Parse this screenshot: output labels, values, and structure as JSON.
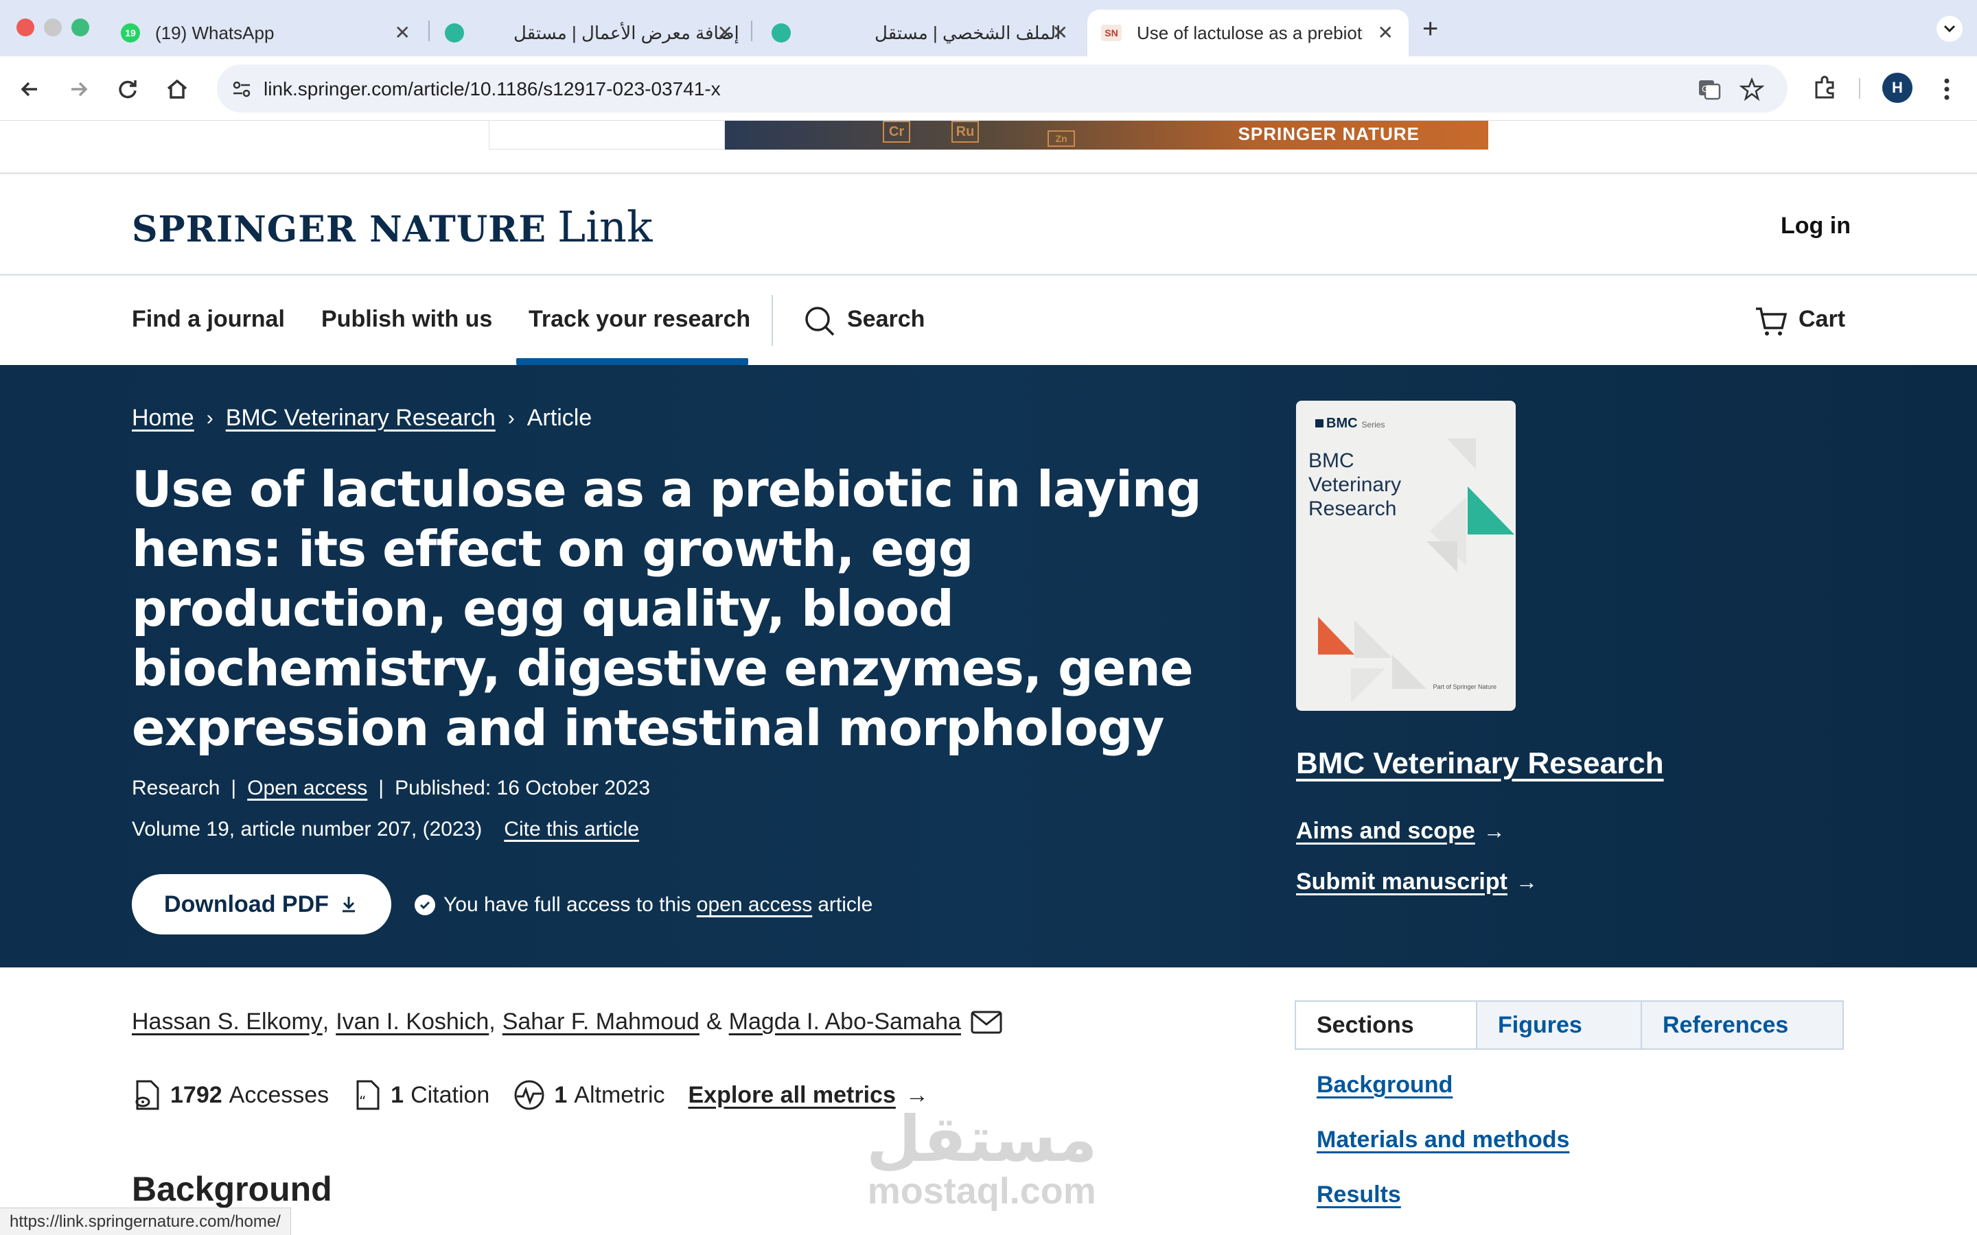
{
  "browser": {
    "tabs": [
      {
        "title": "(19) WhatsApp",
        "badge": "19"
      },
      {
        "title": "إضافة معرض الأعمال | مستقل"
      },
      {
        "title": "الملف الشخصي | مستقل"
      },
      {
        "title": "Use of lactulose as a prebiotic",
        "favicon_text": "SN"
      }
    ],
    "url": "link.springer.com/article/10.1186/s12917-023-03741-x",
    "profile_initial": "H",
    "status_url": "https://link.springernature.com/home/"
  },
  "ad": {
    "text": "SPRINGER NATURE",
    "chips": [
      "Cr",
      "Ru",
      "Zn"
    ]
  },
  "header": {
    "brand_main": "SPRINGER NATURE",
    "brand_link": "Link",
    "login": "Log in"
  },
  "nav": {
    "find_journal": "Find a journal",
    "publish": "Publish with us",
    "track": "Track your research",
    "search": "Search",
    "cart": "Cart"
  },
  "breadcrumb": {
    "home": "Home",
    "journal": "BMC Veterinary Research",
    "current": "Article"
  },
  "article": {
    "title": "Use of lactulose as a prebiotic in laying hens: its effect on growth, egg production, egg quality, blood biochemistry, digestive enzymes, gene expression and intestinal morphology",
    "type": "Research",
    "open_access": "Open access",
    "published": "Published: 16 October 2023",
    "volume": "Volume 19, article number 207, (2023)",
    "cite": "Cite this article",
    "download": "Download PDF",
    "access_pre": "You have full access to this",
    "access_link": "open access",
    "access_post": "article",
    "authors": [
      "Hassan S. Elkomy",
      "Ivan I. Koshich",
      "Sahar F. Mahmoud",
      "Magda I. Abo-Samaha"
    ],
    "author_sep": ",",
    "author_amp": "&",
    "metrics": {
      "accesses_num": "1792",
      "accesses_label": "Accesses",
      "citation_num": "1",
      "citation_label": "Citation",
      "altmetric_num": "1",
      "altmetric_label": "Altmetric",
      "explore": "Explore all metrics"
    },
    "section_heading": "Background"
  },
  "journal": {
    "cover_brand": "BMC",
    "cover_series": "Series",
    "cover_name": "BMC Veterinary Research",
    "cover_part": "Part of Springer Nature",
    "name": "BMC Veterinary Research",
    "aims": "Aims and scope",
    "submit": "Submit manuscript"
  },
  "sidebar": {
    "tabs": [
      "Sections",
      "Figures",
      "References"
    ],
    "sections": [
      "Background",
      "Materials and methods",
      "Results"
    ]
  },
  "watermark": {
    "arabic": "مستقل",
    "latin": "mostaql.com"
  },
  "colors": {
    "hero_bg": "#0f3352",
    "link_blue": "#01579b",
    "tabbar": "#dfe6f5"
  }
}
